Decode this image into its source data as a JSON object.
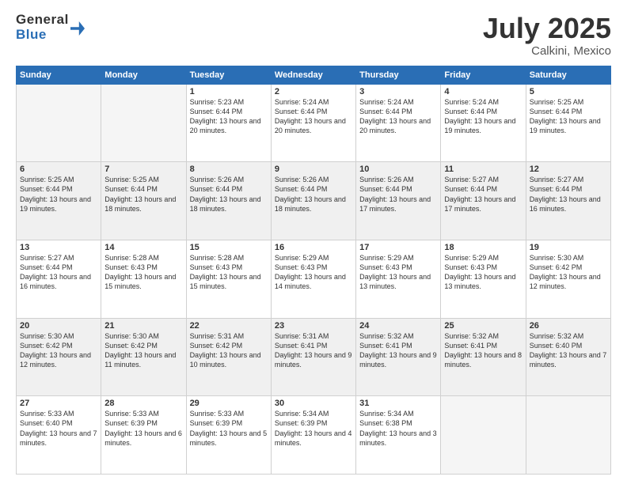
{
  "logo": {
    "general": "General",
    "blue": "Blue"
  },
  "title": "July 2025",
  "subtitle": "Calkini, Mexico",
  "days_header": [
    "Sunday",
    "Monday",
    "Tuesday",
    "Wednesday",
    "Thursday",
    "Friday",
    "Saturday"
  ],
  "weeks": [
    [
      {
        "day": "",
        "sunrise": "",
        "sunset": "",
        "daylight": "",
        "empty": true
      },
      {
        "day": "",
        "sunrise": "",
        "sunset": "",
        "daylight": "",
        "empty": true
      },
      {
        "day": "1",
        "sunrise": "Sunrise: 5:23 AM",
        "sunset": "Sunset: 6:44 PM",
        "daylight": "Daylight: 13 hours and 20 minutes."
      },
      {
        "day": "2",
        "sunrise": "Sunrise: 5:24 AM",
        "sunset": "Sunset: 6:44 PM",
        "daylight": "Daylight: 13 hours and 20 minutes."
      },
      {
        "day": "3",
        "sunrise": "Sunrise: 5:24 AM",
        "sunset": "Sunset: 6:44 PM",
        "daylight": "Daylight: 13 hours and 20 minutes."
      },
      {
        "day": "4",
        "sunrise": "Sunrise: 5:24 AM",
        "sunset": "Sunset: 6:44 PM",
        "daylight": "Daylight: 13 hours and 19 minutes."
      },
      {
        "day": "5",
        "sunrise": "Sunrise: 5:25 AM",
        "sunset": "Sunset: 6:44 PM",
        "daylight": "Daylight: 13 hours and 19 minutes."
      }
    ],
    [
      {
        "day": "6",
        "sunrise": "Sunrise: 5:25 AM",
        "sunset": "Sunset: 6:44 PM",
        "daylight": "Daylight: 13 hours and 19 minutes."
      },
      {
        "day": "7",
        "sunrise": "Sunrise: 5:25 AM",
        "sunset": "Sunset: 6:44 PM",
        "daylight": "Daylight: 13 hours and 18 minutes."
      },
      {
        "day": "8",
        "sunrise": "Sunrise: 5:26 AM",
        "sunset": "Sunset: 6:44 PM",
        "daylight": "Daylight: 13 hours and 18 minutes."
      },
      {
        "day": "9",
        "sunrise": "Sunrise: 5:26 AM",
        "sunset": "Sunset: 6:44 PM",
        "daylight": "Daylight: 13 hours and 18 minutes."
      },
      {
        "day": "10",
        "sunrise": "Sunrise: 5:26 AM",
        "sunset": "Sunset: 6:44 PM",
        "daylight": "Daylight: 13 hours and 17 minutes."
      },
      {
        "day": "11",
        "sunrise": "Sunrise: 5:27 AM",
        "sunset": "Sunset: 6:44 PM",
        "daylight": "Daylight: 13 hours and 17 minutes."
      },
      {
        "day": "12",
        "sunrise": "Sunrise: 5:27 AM",
        "sunset": "Sunset: 6:44 PM",
        "daylight": "Daylight: 13 hours and 16 minutes."
      }
    ],
    [
      {
        "day": "13",
        "sunrise": "Sunrise: 5:27 AM",
        "sunset": "Sunset: 6:44 PM",
        "daylight": "Daylight: 13 hours and 16 minutes."
      },
      {
        "day": "14",
        "sunrise": "Sunrise: 5:28 AM",
        "sunset": "Sunset: 6:43 PM",
        "daylight": "Daylight: 13 hours and 15 minutes."
      },
      {
        "day": "15",
        "sunrise": "Sunrise: 5:28 AM",
        "sunset": "Sunset: 6:43 PM",
        "daylight": "Daylight: 13 hours and 15 minutes."
      },
      {
        "day": "16",
        "sunrise": "Sunrise: 5:29 AM",
        "sunset": "Sunset: 6:43 PM",
        "daylight": "Daylight: 13 hours and 14 minutes."
      },
      {
        "day": "17",
        "sunrise": "Sunrise: 5:29 AM",
        "sunset": "Sunset: 6:43 PM",
        "daylight": "Daylight: 13 hours and 13 minutes."
      },
      {
        "day": "18",
        "sunrise": "Sunrise: 5:29 AM",
        "sunset": "Sunset: 6:43 PM",
        "daylight": "Daylight: 13 hours and 13 minutes."
      },
      {
        "day": "19",
        "sunrise": "Sunrise: 5:30 AM",
        "sunset": "Sunset: 6:42 PM",
        "daylight": "Daylight: 13 hours and 12 minutes."
      }
    ],
    [
      {
        "day": "20",
        "sunrise": "Sunrise: 5:30 AM",
        "sunset": "Sunset: 6:42 PM",
        "daylight": "Daylight: 13 hours and 12 minutes."
      },
      {
        "day": "21",
        "sunrise": "Sunrise: 5:30 AM",
        "sunset": "Sunset: 6:42 PM",
        "daylight": "Daylight: 13 hours and 11 minutes."
      },
      {
        "day": "22",
        "sunrise": "Sunrise: 5:31 AM",
        "sunset": "Sunset: 6:42 PM",
        "daylight": "Daylight: 13 hours and 10 minutes."
      },
      {
        "day": "23",
        "sunrise": "Sunrise: 5:31 AM",
        "sunset": "Sunset: 6:41 PM",
        "daylight": "Daylight: 13 hours and 9 minutes."
      },
      {
        "day": "24",
        "sunrise": "Sunrise: 5:32 AM",
        "sunset": "Sunset: 6:41 PM",
        "daylight": "Daylight: 13 hours and 9 minutes."
      },
      {
        "day": "25",
        "sunrise": "Sunrise: 5:32 AM",
        "sunset": "Sunset: 6:41 PM",
        "daylight": "Daylight: 13 hours and 8 minutes."
      },
      {
        "day": "26",
        "sunrise": "Sunrise: 5:32 AM",
        "sunset": "Sunset: 6:40 PM",
        "daylight": "Daylight: 13 hours and 7 minutes."
      }
    ],
    [
      {
        "day": "27",
        "sunrise": "Sunrise: 5:33 AM",
        "sunset": "Sunset: 6:40 PM",
        "daylight": "Daylight: 13 hours and 7 minutes."
      },
      {
        "day": "28",
        "sunrise": "Sunrise: 5:33 AM",
        "sunset": "Sunset: 6:39 PM",
        "daylight": "Daylight: 13 hours and 6 minutes."
      },
      {
        "day": "29",
        "sunrise": "Sunrise: 5:33 AM",
        "sunset": "Sunset: 6:39 PM",
        "daylight": "Daylight: 13 hours and 5 minutes."
      },
      {
        "day": "30",
        "sunrise": "Sunrise: 5:34 AM",
        "sunset": "Sunset: 6:39 PM",
        "daylight": "Daylight: 13 hours and 4 minutes."
      },
      {
        "day": "31",
        "sunrise": "Sunrise: 5:34 AM",
        "sunset": "Sunset: 6:38 PM",
        "daylight": "Daylight: 13 hours and 3 minutes."
      },
      {
        "day": "",
        "sunrise": "",
        "sunset": "",
        "daylight": "",
        "empty": true
      },
      {
        "day": "",
        "sunrise": "",
        "sunset": "",
        "daylight": "",
        "empty": true
      }
    ]
  ]
}
